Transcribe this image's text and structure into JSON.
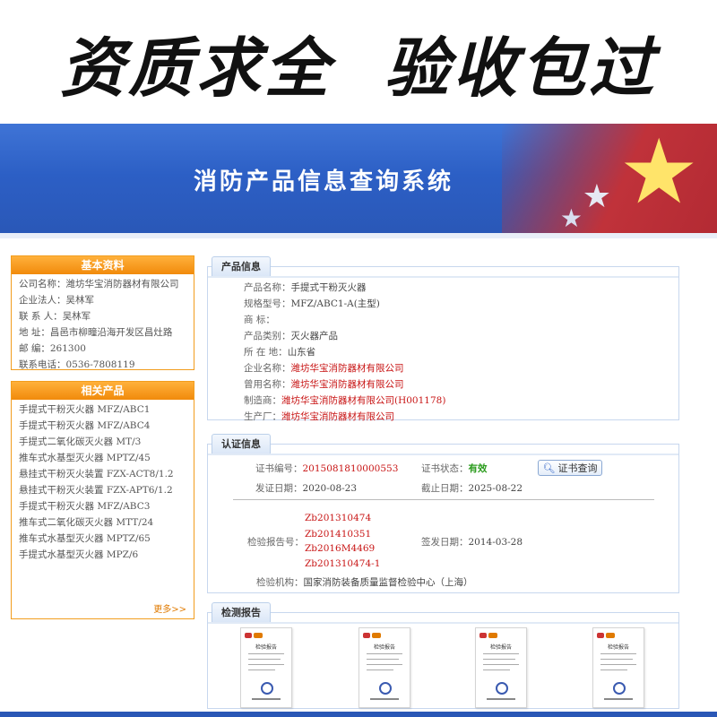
{
  "banner": {
    "slogan": "资质求全  验收包过"
  },
  "header": {
    "title": "消防产品信息查询系统"
  },
  "basic": {
    "title": "基本资料",
    "rows": [
      {
        "k": "公司名称：",
        "v": "潍坊华宝消防器材有限公司"
      },
      {
        "k": "企业法人：",
        "v": "吴林军"
      },
      {
        "k": "联 系 人：",
        "v": "吴林军"
      },
      {
        "k": "地    址：",
        "v": "昌邑市柳疃沿海开发区昌灶路"
      },
      {
        "k": "邮    编：",
        "v": "261300"
      },
      {
        "k": "联系电话：",
        "v": "0536-7808119"
      }
    ]
  },
  "related": {
    "title": "相关产品",
    "items": [
      "手提式干粉灭火器 MFZ/ABC1",
      "手提式干粉灭火器 MFZ/ABC4",
      "手提式二氧化碳灭火器 MT/3",
      "推车式水基型灭火器 MPTZ/45",
      "悬挂式干粉灭火装置 FZX-ACT8/1.2",
      "悬挂式干粉灭火装置 FZX-APT6/1.2",
      "手提式干粉灭火器 MFZ/ABC3",
      "推车式二氧化碳灭火器 MTT/24",
      "推车式水基型灭火器 MPTZ/65",
      "手提式水基型灭火器 MPZ/6"
    ],
    "more": "更多>>"
  },
  "product": {
    "tab": "产品信息",
    "rows": [
      {
        "k": "产品名称：",
        "v": "手提式干粉灭火器"
      },
      {
        "k": "规格型号：",
        "v": "MFZ/ABC1-A(主型)"
      },
      {
        "k": "商      标：",
        "v": ""
      },
      {
        "k": "产品类别：",
        "v": "灭火器产品"
      },
      {
        "k": "所 在 地：",
        "v": "山东省"
      },
      {
        "k": "企业名称：",
        "v": "潍坊华宝消防器材有限公司"
      },
      {
        "k": "曾用名称：",
        "v": "潍坊华宝消防器材有限公司"
      },
      {
        "k": "制造商：",
        "v": "潍坊华宝消防器材有限公司(H001178)"
      },
      {
        "k": "生产厂：",
        "v": "潍坊华宝消防器材有限公司"
      }
    ]
  },
  "cert": {
    "tab": "认证信息",
    "cert_no_label": "证书编号：",
    "cert_no": "2015081810000553",
    "status_label": "证书状态：",
    "status": "有效",
    "query_button": "证书查询",
    "issue_label": "发证日期：",
    "issue_date": "2020-08-23",
    "expire_label": "截止日期：",
    "expire_date": "2025-08-22",
    "report_label": "检验报告号：",
    "reports": [
      "Zb201310474",
      "Zb201410351",
      "Zb2016M4469",
      "Zb201310474-1"
    ],
    "sign_label": "签发日期：",
    "sign_date": "2014-03-28",
    "org_label": "检验机构：",
    "org": "国家消防装备质量监督检验中心（上海）"
  },
  "reports_section": {
    "tab": "检测报告",
    "thumb_title": "检验报告"
  },
  "colors": {
    "header_blue": "#2c5fc5",
    "orange": "#f18a0b",
    "red_text": "#c81515",
    "green_text": "#2a9b1c"
  },
  "icons": {
    "query_button": "magnifier-icon"
  }
}
